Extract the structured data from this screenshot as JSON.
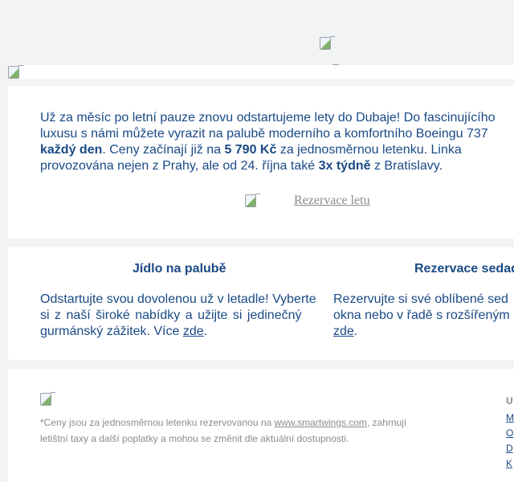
{
  "header": {
    "logo_icon": "broken-image-icon"
  },
  "banner": {
    "image_icon": "broken-image-icon"
  },
  "intro": {
    "line1": "Už za měsíc po letní pauze znovu odstartujeme lety do Dubaje! Do fascinujícího",
    "line2": "luxusu s námi můžete vyrazit na palubě moderního a komfortního Boeingu 737",
    "line3_bold": "každý den",
    "line3_rest1": ". Ceny začínají již na ",
    "price": "5 790 Kč",
    "line3_rest2": " za jednosměrnou letenku. Linka",
    "line4_start": "provozována nejen z Prahy, ale od 24. října také ",
    "frequency": "3x týdně",
    "line4_end": " z Bratislavy.",
    "reservation_link": "Rezervace letu"
  },
  "features": {
    "food": {
      "title": "Jídlo na palubě",
      "line1": "Odstartujte svou dovolenou už v letadle! Vyberte",
      "line2": "si z naší široké nabídky a užijte si jedinečný",
      "line3": "gurmánský zážitek. Více ",
      "link": "zde",
      "after": "."
    },
    "seat": {
      "title": "Rezervace sedad",
      "line1": "Rezervujte si své oblíbené sed",
      "line2": "okna nebo v řadě s rozšířeným",
      "link": "zde",
      "after": "."
    }
  },
  "footer": {
    "note_line1": "*Ceny jsou za jednosměrnou letenku rezervovanou na ",
    "note_link": "www.smartwings.com",
    "note_line1_end": ", zahrnují",
    "note_line2": "letištní taxy a další poplatky a mohou se změnit dle aktuální dostupnosti.",
    "nav_head": "U",
    "nav_items": [
      "M",
      "O",
      "D",
      "K"
    ]
  },
  "colors": {
    "primary_text": "#1a4a86",
    "muted_text": "#8c8c8c",
    "background": "#f2f3f5",
    "card": "#ffffff"
  }
}
